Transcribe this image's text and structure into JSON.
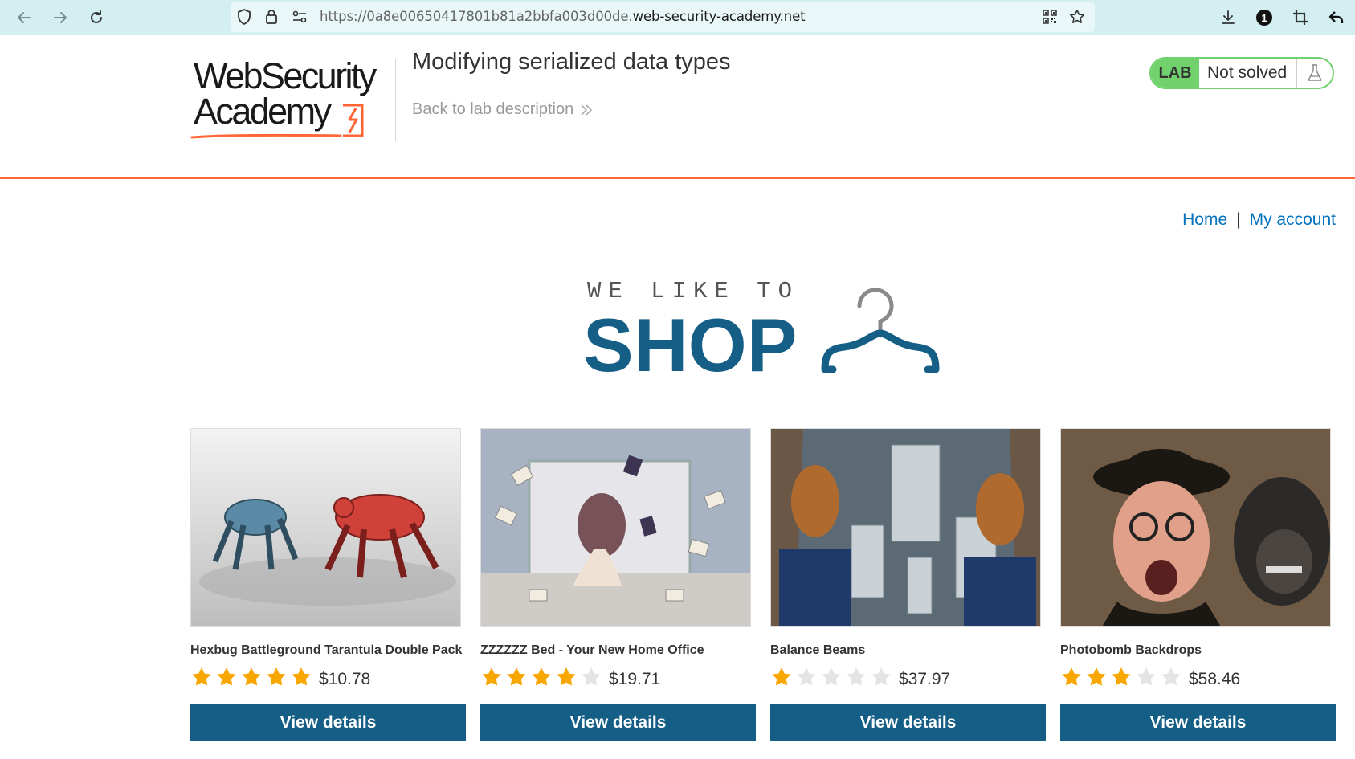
{
  "browser": {
    "url_prefix": "https://0a8e00650417801b81a2bbfa003d00de.",
    "url_host": "web-security-academy.net",
    "account_badge": "1",
    "icons": [
      "back-arrow",
      "forward-arrow",
      "reload",
      "shield",
      "lock",
      "permissions",
      "qr-code",
      "star-bookmark",
      "download",
      "account-badge",
      "crop",
      "undo"
    ]
  },
  "lab": {
    "logo_line1": "WebSecurity",
    "logo_line2": "Academy",
    "title": "Modifying serialized data types",
    "back_link": "Back to lab description",
    "status_tag": "LAB",
    "status_text": "Not solved"
  },
  "nav": {
    "home": "Home",
    "separator": "|",
    "my_account": "My account"
  },
  "hero": {
    "tagline": "WE LIKE TO",
    "shop": "SHOP"
  },
  "colors": {
    "accent_orange": "#ff6633",
    "brand_blue": "#155e86",
    "lab_green": "#70d16d",
    "star_gold": "#f8a600",
    "link_blue": "#0071bc"
  },
  "products": [
    {
      "name": "Hexbug Battleground Tarantula Double Pack",
      "rating": 5,
      "price": "$10.78",
      "button": "View details"
    },
    {
      "name": "ZZZZZZ Bed - Your New Home Office",
      "rating": 4,
      "price": "$19.71",
      "button": "View details"
    },
    {
      "name": "Balance Beams",
      "rating": 1,
      "price": "$37.97",
      "button": "View details"
    },
    {
      "name": "Photobomb Backdrops",
      "rating": 3,
      "price": "$58.46",
      "button": "View details"
    }
  ]
}
